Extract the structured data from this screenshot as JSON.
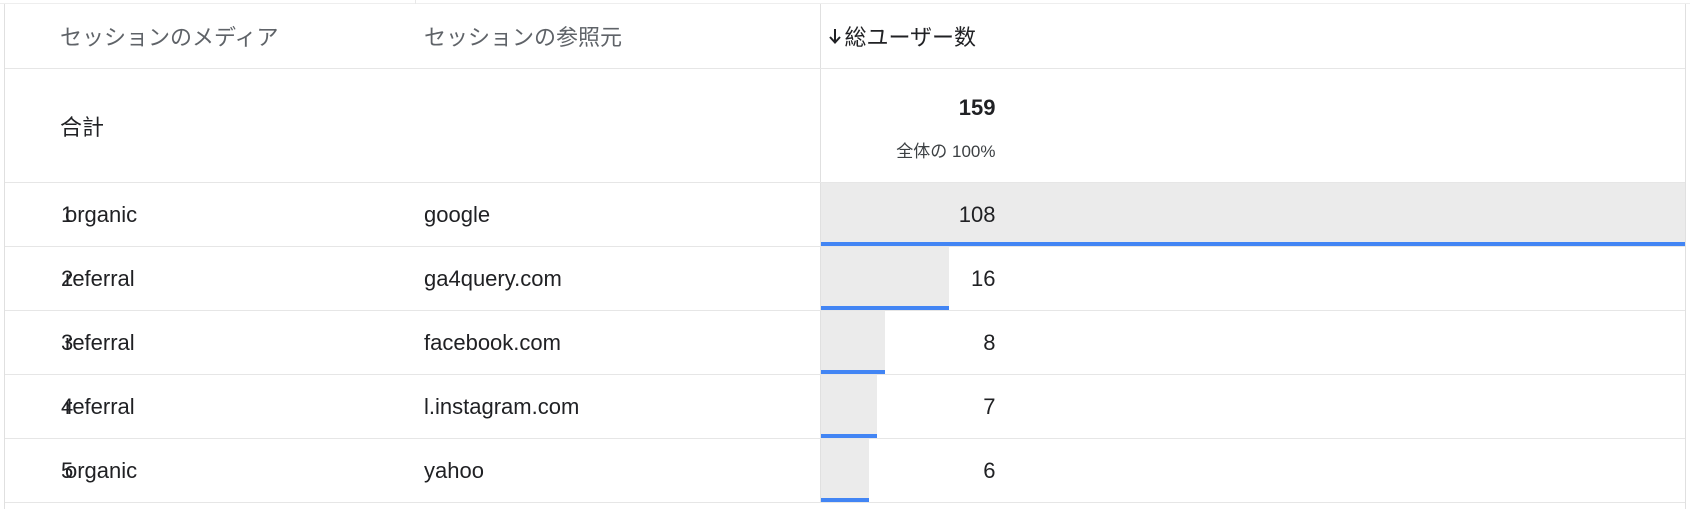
{
  "table": {
    "headers": {
      "medium": "セッションのメディア",
      "source": "セッションの参照元",
      "users": "総ユーザー数"
    },
    "total": {
      "label": "合計",
      "value": "159",
      "share": "全体の 100%"
    },
    "rows": [
      {
        "rank": "1",
        "medium": "organic",
        "source": "google",
        "users": "108",
        "share": 1.0
      },
      {
        "rank": "2",
        "medium": "referral",
        "source": "ga4query.com",
        "users": "16",
        "share": 0.1481
      },
      {
        "rank": "3",
        "medium": "referral",
        "source": "facebook.com",
        "users": "8",
        "share": 0.0741
      },
      {
        "rank": "4",
        "medium": "referral",
        "source": "l.instagram.com",
        "users": "7",
        "share": 0.0648
      },
      {
        "rank": "5",
        "medium": "organic",
        "source": "yahoo",
        "users": "6",
        "share": 0.0556
      }
    ]
  },
  "icons": {
    "sort": "arrow-down-icon"
  },
  "colors": {
    "bar_fill": "#ebebeb",
    "bar_accent": "#4285f4"
  }
}
